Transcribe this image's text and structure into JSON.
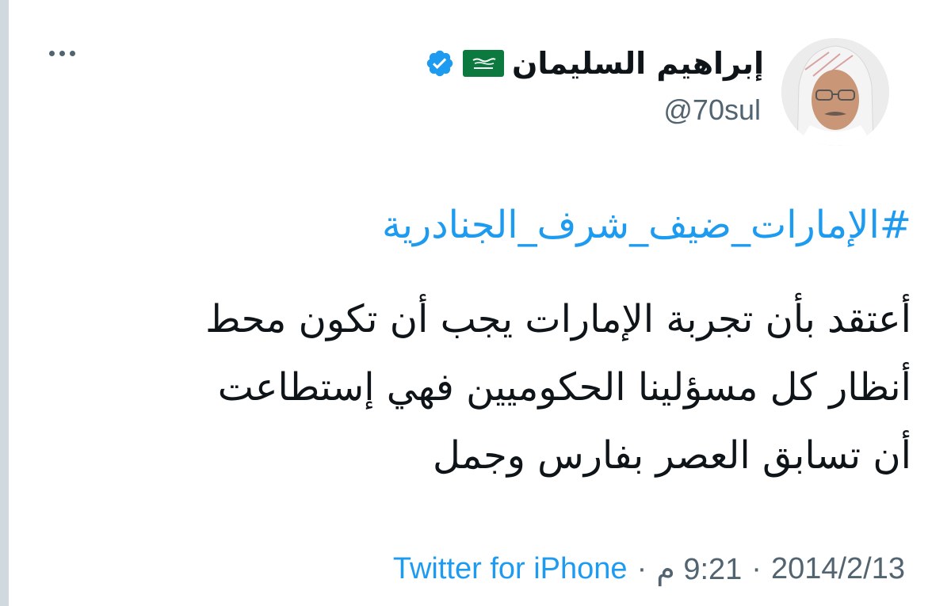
{
  "tweet": {
    "display_name": "إبراهيم السليمان",
    "handle": "@70sul",
    "hashtag": "#الإمارات_ضيف_شرف_الجنادرية",
    "body_lines": [
      "أعتقد بأن تجربة الإمارات يجب أن تكون محط",
      "أنظار كل مسؤلينا الحكوميين فهي إستطاعت",
      "أن تسابق العصر بفارس وجمل"
    ],
    "date": "2014/2/13",
    "separator": "·",
    "time": "9:21 م",
    "source": "Twitter for iPhone"
  },
  "icons": {
    "flag": "saudi-flag-icon",
    "verified": "verified-badge-icon",
    "more": "more-options-icon",
    "avatar": "profile-avatar"
  },
  "colors": {
    "accent_blue": "#1d9bf0",
    "secondary_text": "#536471",
    "flag_green": "#0c7a3f"
  }
}
